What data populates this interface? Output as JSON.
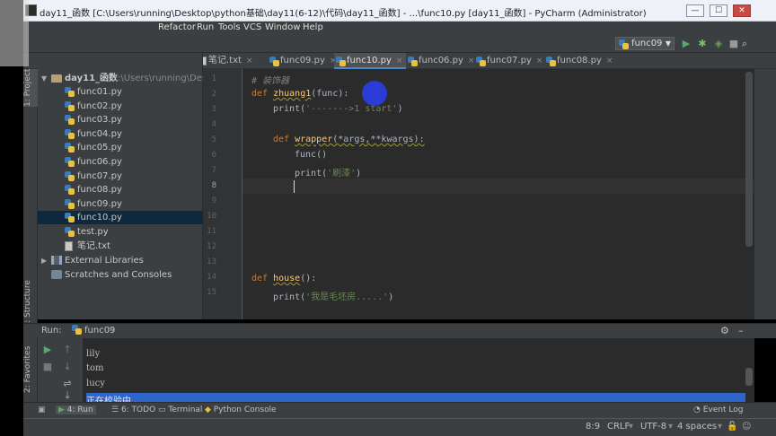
{
  "window": {
    "title": "day11_函数 [C:\\Users\\running\\Desktop\\python基础\\day11(6-12)\\代码\\day11_函数] - ...\\func10.py [day11_函数] - PyCharm (Administrator)",
    "min": "—",
    "max": "☐",
    "close": "✕"
  },
  "menu": [
    "Refactor",
    "Run",
    "Tools",
    "VCS",
    "Window",
    "Help"
  ],
  "toolbar": {
    "run_config": "func09"
  },
  "tabs": [
    {
      "label": "笔记.txt",
      "type": "txt"
    },
    {
      "label": "func09.py",
      "type": "py"
    },
    {
      "label": "func10.py",
      "type": "py",
      "active": true
    },
    {
      "label": "func06.py",
      "type": "py"
    },
    {
      "label": "func07.py",
      "type": "py"
    },
    {
      "label": "func08.py",
      "type": "py"
    }
  ],
  "sidebar_tabs": {
    "project": "1: Project",
    "structure": "Z: Structure",
    "favorites": "2: Favorites"
  },
  "project": {
    "root": "day11_函数",
    "root_path": "C:\\Users\\running\\Desktop",
    "files": [
      "func01.py",
      "func02.py",
      "func03.py",
      "func04.py",
      "func05.py",
      "func06.py",
      "func07.py",
      "func08.py",
      "func09.py",
      "func10.py",
      "test.py",
      "笔记.txt"
    ],
    "selected": "func10.py",
    "libraries": "External Libraries",
    "scratches": "Scratches and Consoles"
  },
  "editor": {
    "line_numbers": [
      "1",
      "2",
      "3",
      "4",
      "5",
      "6",
      "7",
      "8",
      "9",
      "10",
      "11",
      "12",
      "13",
      "14",
      "15"
    ],
    "lines": {
      "l1_comment": "# 装饰器",
      "l2_def": "def ",
      "l2_name": "zhuang1",
      "l2_rest": "(func):",
      "l3_print": "print(",
      "l3_str": "'------->1 start'",
      "l3_close": ")",
      "l5_def": "def ",
      "l5_name": "wrapper",
      "l5_rest": "(*args,**kwargs):",
      "l6_call": "func()",
      "l7_print": "print(",
      "l7_str": "'刷漆'",
      "l7_close": ")",
      "l14_def": "def ",
      "l14_name": "house",
      "l14_rest": "():",
      "l15_print": "print(",
      "l15_str": "'我是毛坯房.....'",
      "l15_close": ")"
    }
  },
  "run": {
    "label": "Run:",
    "config": "func09",
    "output": [
      "lily",
      "tom",
      "lucy",
      "正在校验中......"
    ]
  },
  "bottom_tabs": [
    "4: Run",
    "6: TODO",
    "Terminal",
    "Python Console"
  ],
  "event_log": "Event Log",
  "status": {
    "position": "8:9",
    "line_sep": "CRLF",
    "encoding": "UTF-8",
    "indent": "4 spaces"
  }
}
